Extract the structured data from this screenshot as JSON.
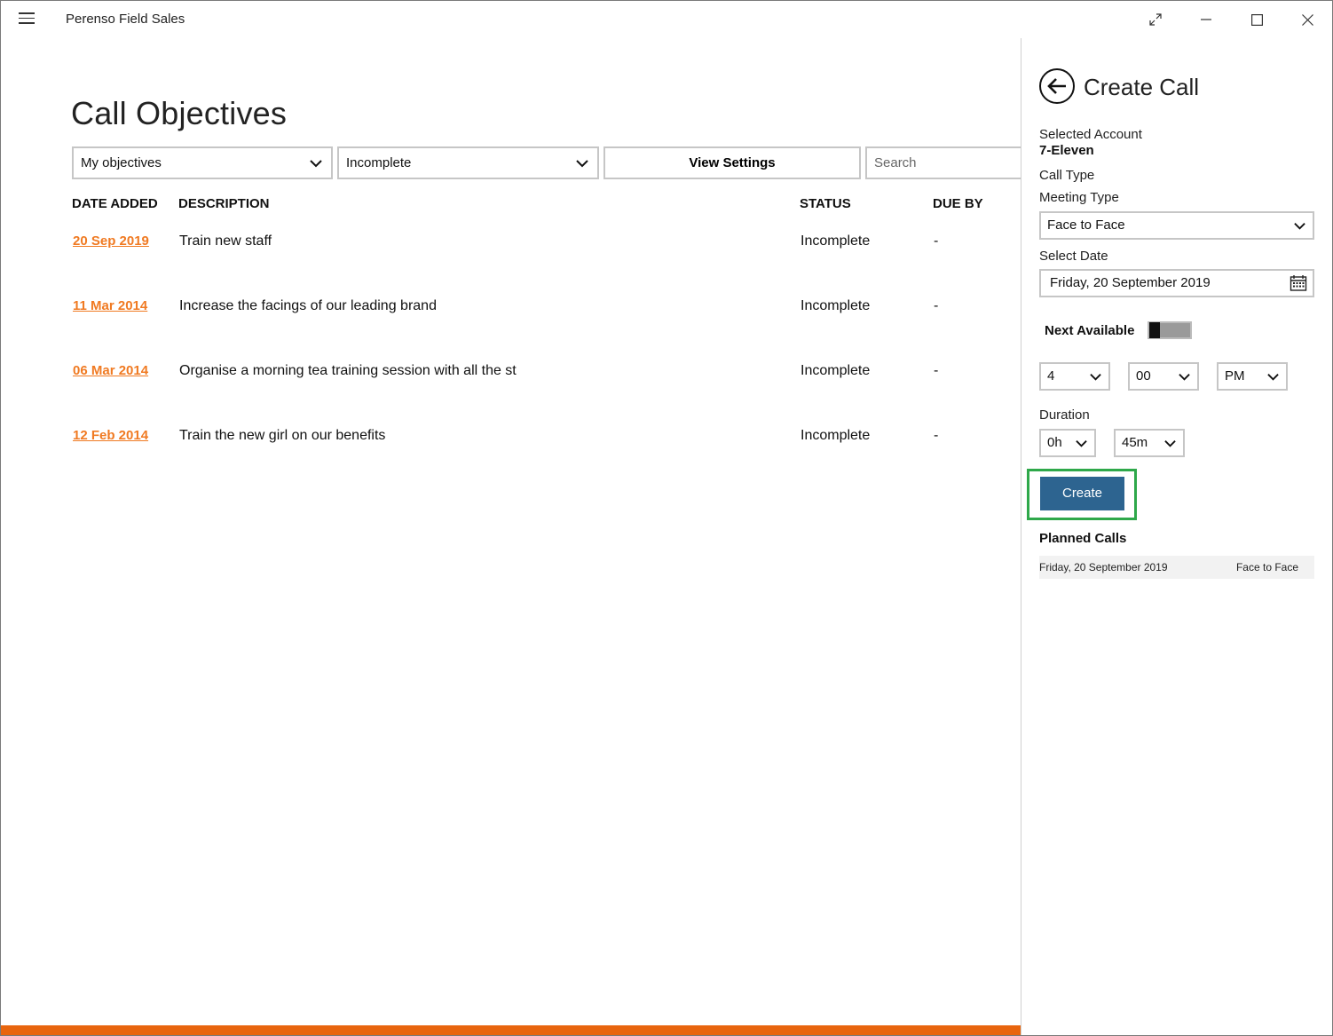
{
  "app": {
    "title": "Perenso Field Sales"
  },
  "page": {
    "title": "Call Objectives"
  },
  "filters": {
    "owner": "My objectives",
    "status": "Incomplete",
    "view_settings_label": "View Settings",
    "search_placeholder": "Search"
  },
  "table": {
    "columns": [
      "DATE ADDED",
      "DESCRIPTION",
      "STATUS",
      "DUE BY"
    ],
    "rows": [
      {
        "date": "20 Sep 2019",
        "description": "Train new staff",
        "status": "Incomplete",
        "due": "-"
      },
      {
        "date": "11 Mar 2014",
        "description": "Increase the facings of our leading brand",
        "status": "Incomplete",
        "due": "-"
      },
      {
        "date": "06 Mar 2014",
        "description": "Organise a morning tea training session with all the st",
        "status": "Incomplete",
        "due": "-"
      },
      {
        "date": "12 Feb 2014",
        "description": "Train the new girl on our benefits",
        "status": "Incomplete",
        "due": "-"
      }
    ]
  },
  "panel": {
    "title": "Create Call",
    "selected_account_label": "Selected Account",
    "selected_account_value": "7-Eleven",
    "call_type_label": "Call Type",
    "meeting_type_label": "Meeting Type",
    "meeting_type_value": "Face to Face",
    "select_date_label": "Select Date",
    "date_value": "Friday, 20 September 2019",
    "next_available_label": "Next Available",
    "hour": "4",
    "minute": "00",
    "ampm": "PM",
    "duration_label": "Duration",
    "duration_hours": "0h",
    "duration_minutes": "45m",
    "create_label": "Create",
    "planned_calls_label": "Planned Calls",
    "planned_calls": [
      {
        "date": "Friday, 20 September 2019",
        "type": "Face to Face"
      }
    ]
  },
  "colors": {
    "accent_orange": "#e8650e",
    "link_orange": "#f07a22",
    "button_blue": "#2d6490",
    "highlight_green": "#2ea84a"
  }
}
